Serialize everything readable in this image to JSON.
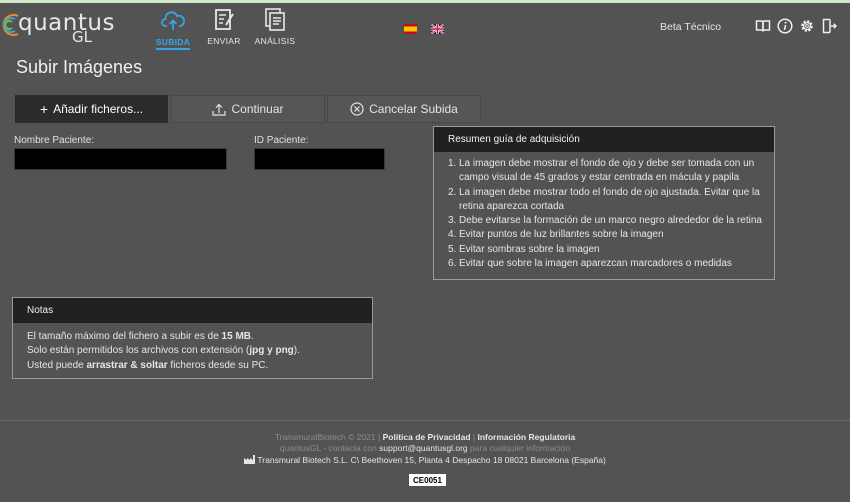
{
  "app": {
    "logo_word": "quantus",
    "logo_suffix": "GL"
  },
  "nav": [
    {
      "label": "SUBIDA",
      "icon": "cloud-upload-icon",
      "active": true
    },
    {
      "label": "ENVIAR",
      "icon": "send-document-icon",
      "active": false
    },
    {
      "label": "ANÁLISIS",
      "icon": "analysis-document-icon",
      "active": false
    }
  ],
  "header": {
    "user": "Beta Técnico",
    "icons": [
      "book-icon",
      "info-icon",
      "gear-icon",
      "logout-icon"
    ],
    "languages": [
      "spanish-flag-icon",
      "uk-flag-icon"
    ]
  },
  "page": {
    "title": "Subir Imágenes"
  },
  "toolbar": {
    "add_label": "Añadir ficheros...",
    "continue_label": "Continuar",
    "cancel_label": "Cancelar Subida"
  },
  "form": {
    "patient_name_label": "Nombre Paciente:",
    "patient_name_value": "",
    "patient_id_label": "ID Paciente:",
    "patient_id_value": ""
  },
  "guide": {
    "title": "Resumen guía de adquisición",
    "items": [
      {
        "n": "1.",
        "text": "La imagen debe mostrar el fondo de ojo y debe ser tomada con un campo visual de 45 grados y estar centrada en mácula y papila"
      },
      {
        "n": "2.",
        "text": "La imagen debe mostrar todo el fondo de ojo ajustada. Evitar que la retina aparezca cortada"
      },
      {
        "n": "3.",
        "text": "Debe evitarse la formación de un marco negro alrededor de la retina"
      },
      {
        "n": "4.",
        "text": "Evitar puntos de luz brillantes sobre la imagen"
      },
      {
        "n": "5.",
        "text": "Evitar sombras sobre la imagen"
      },
      {
        "n": "6.",
        "text": "Evitar que sobre la imagen aparezcan marcadores o medidas"
      }
    ]
  },
  "notes": {
    "title": "Notas",
    "l1_pre": "El tamaño máximo del fichero a subir es de ",
    "l1_bold": "15 MB",
    "l1_post": ".",
    "l2_pre": "Solo están permitidos los archivos con extensión (",
    "l2_bold": "jpg y png",
    "l2_post": ").",
    "l3_pre": "Usted puede ",
    "l3_bold": "arrastrar & soltar",
    "l3_post": " ficheros desde su PC."
  },
  "footer": {
    "copyright": "TransmuralBiotech © 2021",
    "sep": "|",
    "privacy": "Política de Privacidad",
    "regulatory": "Información Regulatoria",
    "contact_pre": "quantusGL - contacta con ",
    "contact_email": "support@quantusgl.org",
    "contact_post": " para cualquier información",
    "address": "Transmural Biotech S.L. C\\ Beethoven 15, Planta 4 Despacho 18 08021 Barcelona (España)",
    "ce_mark": "CE0051"
  }
}
